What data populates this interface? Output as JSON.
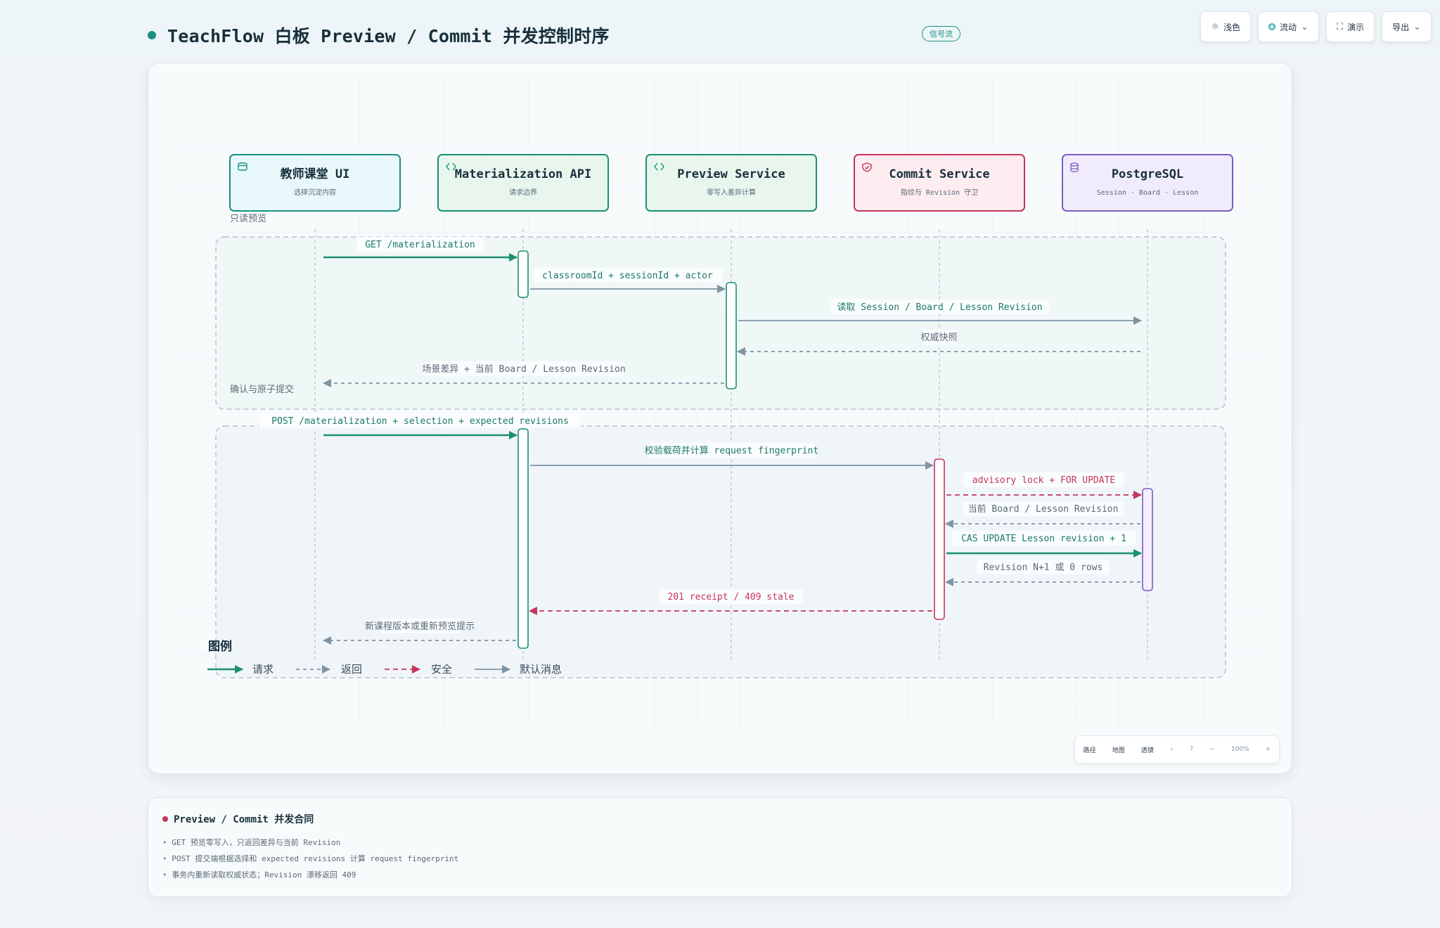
{
  "header": {
    "title": "TeachFlow 白板 Preview / Commit 并发控制时序",
    "badge": "信号流"
  },
  "toolbar": {
    "theme_label": "浅色",
    "flow_label": "流动",
    "present_label": "演示",
    "export_label": "导出"
  },
  "participants": [
    {
      "id": "ui",
      "title": "教师课堂 UI",
      "subtitle": "选择沉淀内容",
      "icon": "window-icon",
      "color": "#1b8f86",
      "fill": "#e9f8fa"
    },
    {
      "id": "api",
      "title": "Materialization API",
      "subtitle": "请求边界",
      "icon": "code-icon",
      "color": "#1b8f6e",
      "fill": "#e8f6ee"
    },
    {
      "id": "preview",
      "title": "Preview Service",
      "subtitle": "零写入差异计算",
      "icon": "code-icon",
      "color": "#1b8f6e",
      "fill": "#e8f6ee"
    },
    {
      "id": "commit",
      "title": "Commit Service",
      "subtitle": "指纹与 Revision 守卫",
      "icon": "shield-icon",
      "color": "#c4365a",
      "fill": "#fdecf0"
    },
    {
      "id": "db",
      "title": "PostgreSQL",
      "subtitle": "Session · Board · Lesson",
      "icon": "database-icon",
      "color": "#7b5cc4",
      "fill": "#f1ecfb"
    }
  ],
  "groups": [
    {
      "label": "只读预览"
    },
    {
      "label": "确认与原子提交"
    }
  ],
  "messages": [
    {
      "from": 0,
      "to": 1,
      "label": "GET /materialization",
      "style": "request"
    },
    {
      "from": 1,
      "to": 2,
      "label": "classroomId + sessionId + actor",
      "style": "default"
    },
    {
      "from": 2,
      "to": 4,
      "label": "读取 Session / Board / Lesson Revision",
      "style": "default"
    },
    {
      "from": 4,
      "to": 2,
      "label": "权威快照",
      "style": "return"
    },
    {
      "from": 2,
      "to": 0,
      "label": "场景差异 + 当前 Board / Lesson Revision",
      "style": "return"
    },
    {
      "from": 0,
      "to": 1,
      "label": "POST /materialization + selection + expected revisions",
      "style": "request"
    },
    {
      "from": 1,
      "to": 3,
      "label": "校验载荷并计算 request fingerprint",
      "style": "default"
    },
    {
      "from": 3,
      "to": 4,
      "label": "advisory lock + FOR UPDATE",
      "style": "security"
    },
    {
      "from": 4,
      "to": 3,
      "label": "当前 Board / Lesson Revision",
      "style": "return"
    },
    {
      "from": 3,
      "to": 4,
      "label": "CAS UPDATE Lesson revision + 1",
      "style": "request"
    },
    {
      "from": 4,
      "to": 3,
      "label": "Revision N+1 或 0 rows",
      "style": "return"
    },
    {
      "from": 3,
      "to": 1,
      "label": "201 receipt / 409 stale",
      "style": "security"
    },
    {
      "from": 1,
      "to": 0,
      "label": "新课程版本或重新预览提示",
      "style": "return"
    }
  ],
  "legend": {
    "title": "图例",
    "items": [
      {
        "label": "请求",
        "style": "request"
      },
      {
        "label": "返回",
        "style": "return"
      },
      {
        "label": "安全",
        "style": "security"
      },
      {
        "label": "默认消息",
        "style": "default"
      }
    ]
  },
  "zoombar": {
    "path_label": "路径",
    "map_label": "地图",
    "lens_label": "透镜",
    "zoom_level": "100%"
  },
  "notes": {
    "title": "Preview / Commit 并发合同",
    "items": [
      "GET 预览零写入，只返回差异与当前 Revision",
      "POST 提交端根据选择和 expected revisions 计算 request fingerprint",
      "事务内重新读取权威状态；Revision 漂移返回 409"
    ]
  },
  "colors": {
    "request": "#1b8f6e",
    "return": "#7f93a3",
    "security": "#c4365a",
    "default": "#7f93a3"
  }
}
